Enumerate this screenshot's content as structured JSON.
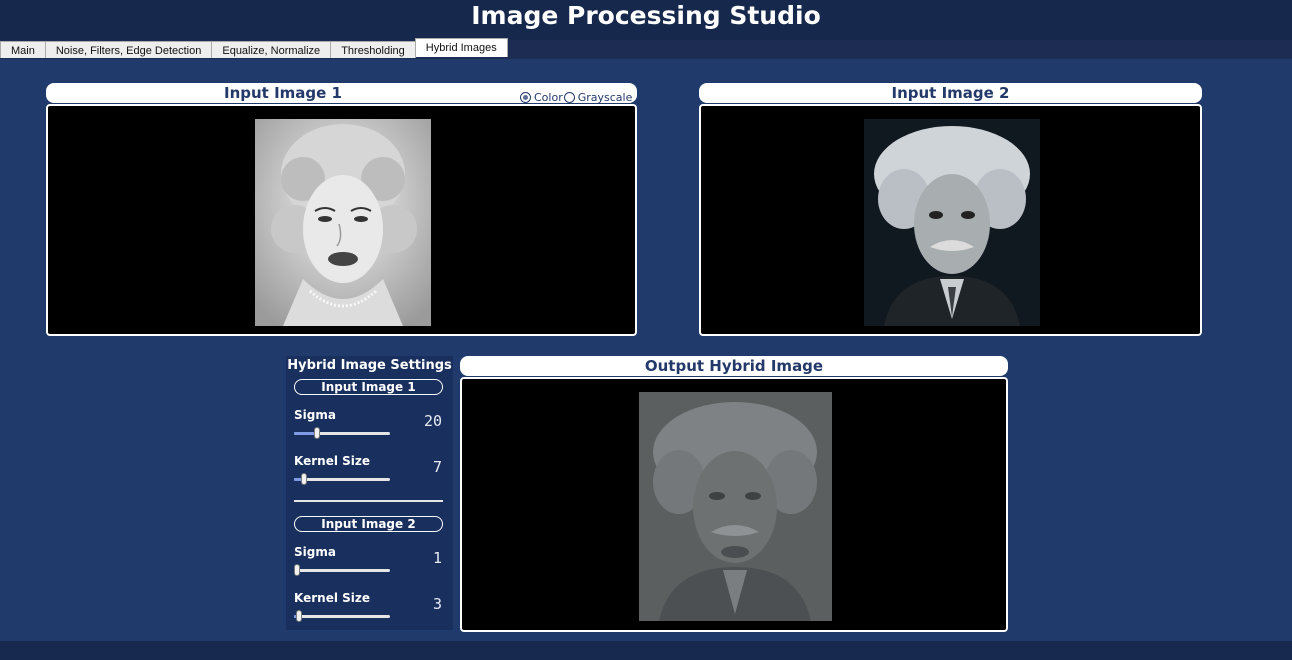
{
  "app": {
    "title": "Image Processing Studio"
  },
  "tabs": [
    {
      "label": "Main"
    },
    {
      "label": "Noise, Filters, Edge Detection"
    },
    {
      "label": "Equalize, Normalize"
    },
    {
      "label": "Thresholding"
    },
    {
      "label": "Hybrid Images",
      "active": true
    }
  ],
  "input1": {
    "title": "Input Image 1",
    "mode_options": [
      "Color",
      "Grayscale"
    ],
    "selected_mode": "Color",
    "image_icon": "portrait-photo-icon"
  },
  "input2": {
    "title": "Input Image 2",
    "image_icon": "portrait-photo-icon"
  },
  "output": {
    "title": "Output Hybrid Image",
    "image_icon": "hybrid-photo-icon"
  },
  "settings": {
    "title": "Hybrid Image Settings",
    "image1": {
      "label": "Input Image 1",
      "sigma_label": "Sigma",
      "sigma_value": "20",
      "sigma_level": 0.22,
      "kernel_label": "Kernel Size",
      "kernel_value": "7",
      "kernel_level": 0.08
    },
    "image2": {
      "label": "Input Image 2",
      "sigma_label": "Sigma",
      "sigma_value": "1",
      "sigma_level": 0.0,
      "kernel_label": "Kernel Size",
      "kernel_value": "3",
      "kernel_level": 0.02
    }
  },
  "colors": {
    "background": "#203a6c",
    "header": "#17284d",
    "panel_text": "#23396a",
    "slider_fill": "#7f9be6"
  }
}
